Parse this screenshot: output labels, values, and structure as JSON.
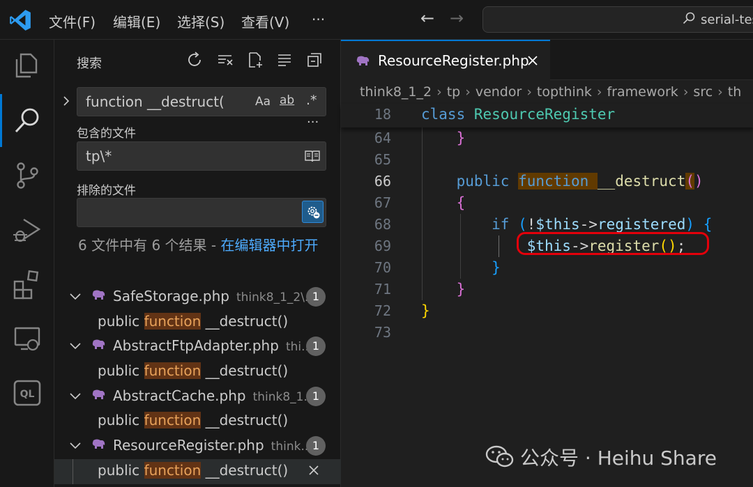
{
  "menu": [
    "文件(F)",
    "编辑(E)",
    "选择(S)",
    "查看(V)",
    "···"
  ],
  "command_center": {
    "text": "serial-tes"
  },
  "search": {
    "title": "搜索",
    "query": "function __destruct(",
    "toggle_case": "Aa",
    "toggle_word": "ab",
    "toggle_regex": ".*",
    "more": "···",
    "include_label": "包含的文件",
    "include_value": "tp\\*",
    "exclude_label": "排除的文件",
    "exclude_value": "",
    "summary_prefix": "6 文件中有 6 个结果 - ",
    "summary_link": "在编辑器中打开"
  },
  "results": [
    {
      "file": "SafeStorage.php",
      "path": "think8_1_2\\...",
      "count": "1",
      "prefix": "public ",
      "match": "function",
      "suffix": " __destruct()"
    },
    {
      "file": "AbstractFtpAdapter.php",
      "path": "thi...",
      "count": "1",
      "prefix": "public ",
      "match": "function",
      "suffix": " __destruct()"
    },
    {
      "file": "AbstractCache.php",
      "path": "think8_1...",
      "count": "1",
      "prefix": "public ",
      "match": "function",
      "suffix": " __destruct()"
    },
    {
      "file": "ResourceRegister.php",
      "path": "think...",
      "count": "1",
      "prefix": "public ",
      "match": "function",
      "suffix": " __destruct()"
    }
  ],
  "editor": {
    "tab": "ResourceRegister.php",
    "breadcrumb": [
      "think8_1_2",
      "tp",
      "vendor",
      "topthink",
      "framework",
      "src",
      "th"
    ],
    "sticky": {
      "line": "18",
      "kw": "class",
      "name": "ResourceRegister"
    },
    "lines": [
      {
        "n": "64",
        "code": "}"
      },
      {
        "n": "65",
        "code": ""
      },
      {
        "n": "66",
        "code": "public function __destruct()"
      },
      {
        "n": "67",
        "code": "{"
      },
      {
        "n": "68",
        "code": "if (!$this->registered) {"
      },
      {
        "n": "69",
        "code": "$this->register();"
      },
      {
        "n": "70",
        "code": "}"
      },
      {
        "n": "71",
        "code": "}"
      },
      {
        "n": "72",
        "code": "}"
      },
      {
        "n": "73",
        "code": ""
      }
    ]
  },
  "watermark": "公众号 · Heihu Share",
  "colors": {
    "accent": "#0078d4",
    "match_bg": "#623315",
    "annotation": "#e3000b"
  }
}
